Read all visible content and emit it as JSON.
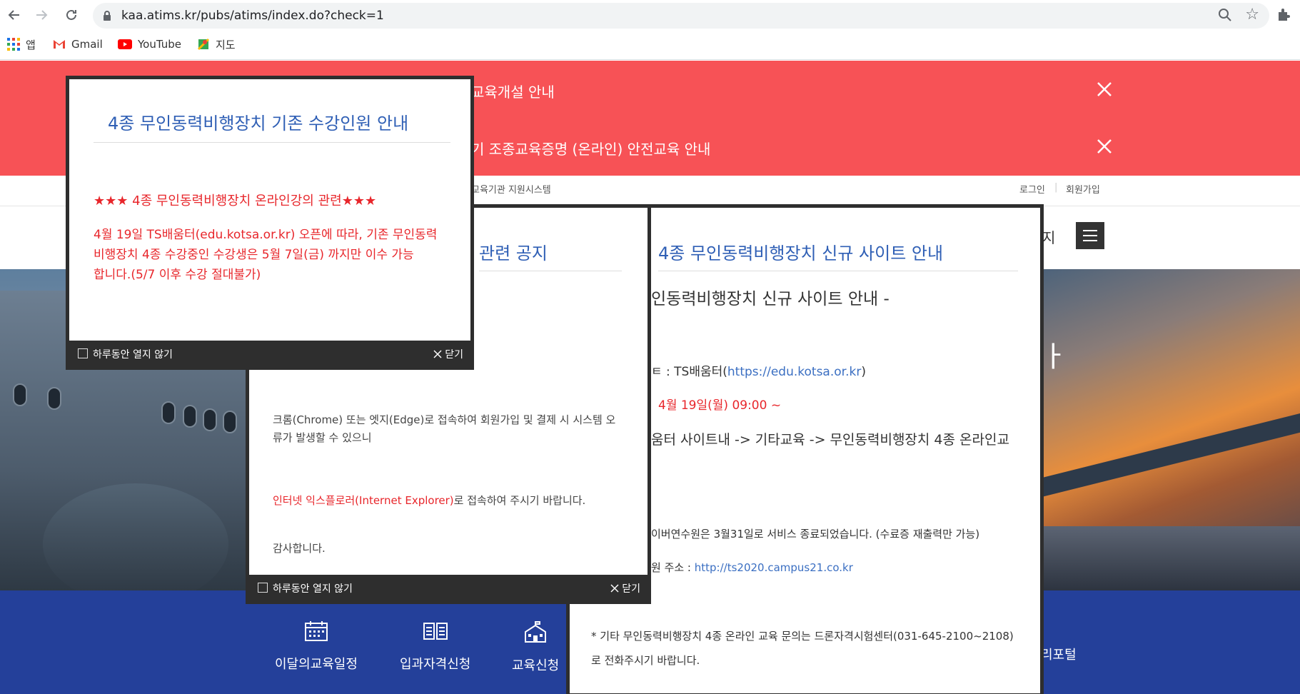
{
  "browser": {
    "url": "kaa.atims.kr/pubs/atims/index.do?check=1",
    "bookmarks": [
      "앱",
      "Gmail",
      "YouTube",
      "지도"
    ]
  },
  "site": {
    "notices": [
      {
        "text": "교육개설 안내"
      },
      {
        "text": "기 조종교육증명 (온라인) 안전교육 안내"
      }
    ],
    "subtitle": "교육기관 지원시스템",
    "login": "로그인",
    "join": "회원가입",
    "menu_partial": "지",
    "hero_partial": "ㅏ",
    "quick_links": [
      "이달의교육일정",
      "입과자격신청",
      "교육신청",
      "리포털"
    ]
  },
  "popup1": {
    "title": "4종 무인동력비행장치 기존 수강인원 안내",
    "heading": "★★★ 4종 무인동력비행장치 온라인강의 관련★★★",
    "body": [
      "4월 19일 TS배움터(edu.kotsa.or.kr) 오픈에 따라, 기존 무인동력",
      "비행장치 4종 수강중인 수강생은 5월 7일(금) 까지만 이수 가능",
      "합니다.(5/7 이후 수강 절대불가)"
    ],
    "dont_show": "하루동안 열지 않기",
    "close": "닫기"
  },
  "popup2": {
    "title": "관련 공지",
    "line1a": "크롬(Chrome) 또는 엣지(Edge)로 접속하여 회원가입 및 결제 시 시스템 오",
    "line1b": "류가 발생할 수 있으니",
    "line2_red": "인터넷 익스플로러(Internet Explorer)",
    "line2_rest": "로 접속하여 주시기 바랍니다.",
    "line3": "감사합니다.",
    "dont_show": "하루동안 열지 않기",
    "close": "닫기"
  },
  "popup3": {
    "title": "4종 무인동력비행장치 신규 사이트 안내",
    "heading": "인동력비행장치 신규 사이트 안내 -",
    "site_prefix": "ㅌ : TS배움터(",
    "site_link": "https://edu.kotsa.or.kr",
    "site_suffix": ")",
    "date": "4월 19일(월) 09:00 ~",
    "path": "움터 사이트내 -> 기타교육 -> 무인동력비행장치 4종 온라인교",
    "end_service": "이버연수원은 3월31일로 서비스 종료되었습니다. (수료증 재출력만 가능)",
    "addr_prefix": "원 주소 : ",
    "addr_link": "http://ts2020.campus21.co.kr",
    "inquiry1": "* 기타 무인동력비행장치 4종 온라인 교육 문의는 드론자격시험센터(031-645-2100~2108)",
    "inquiry2": "로 전화주시기 바랍니다."
  },
  "colors": {
    "notice_bar": "#f75256",
    "popup_title": "#2f5fb5",
    "alert_text": "#e8262b",
    "quick_bar": "#24409a"
  }
}
